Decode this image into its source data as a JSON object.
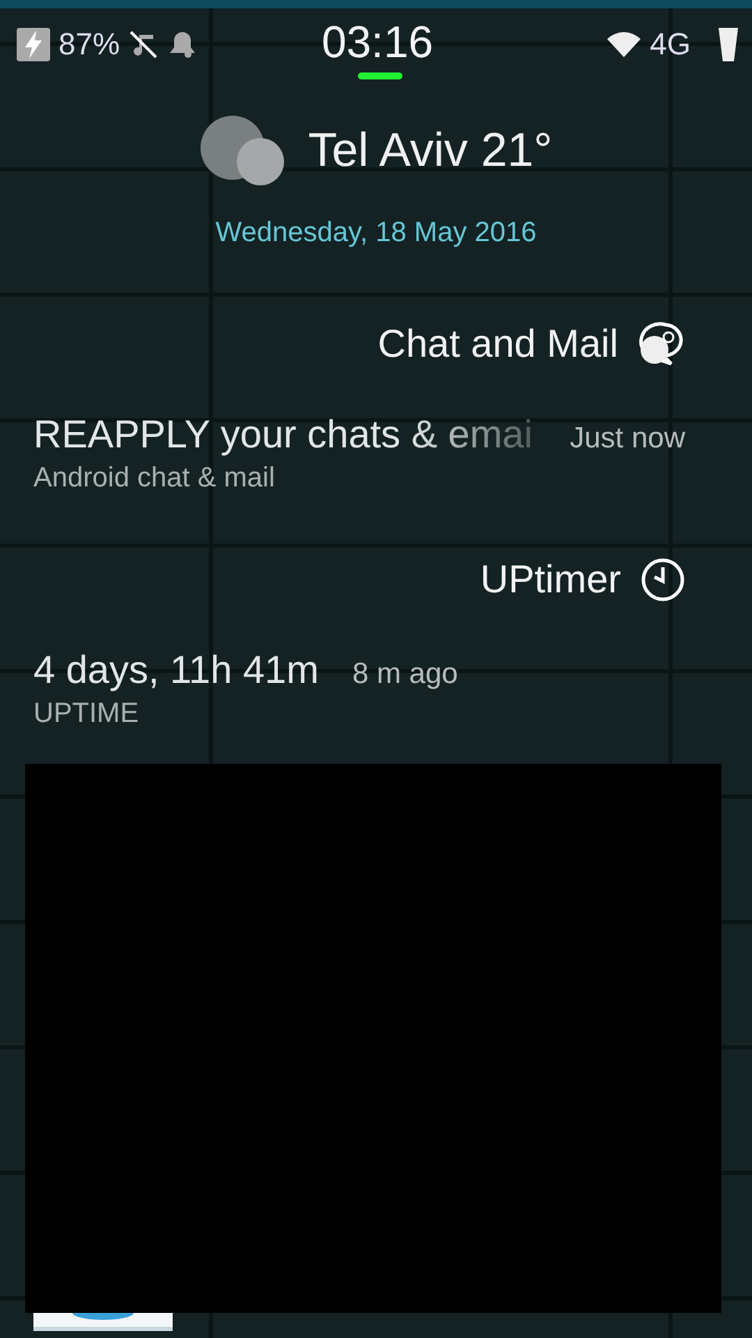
{
  "status_bar": {
    "battery": "87%",
    "time": "03:16",
    "network": "4G"
  },
  "weather": {
    "headline": "Tel Aviv 21°",
    "date": "Wednesday, 18 May 2016"
  },
  "sections": [
    {
      "title": "Chat and Mail",
      "kind": "chat",
      "items": [
        {
          "title": "REAPPLY your chats & emai",
          "time": "Just now",
          "subtitle": "Android chat & mail"
        }
      ]
    },
    {
      "title": "UPtimer",
      "kind": "clock",
      "items": [
        {
          "title": "4 days, 11h 41m",
          "time": "8 m ago",
          "subtitle": "UPTIME"
        }
      ]
    }
  ]
}
